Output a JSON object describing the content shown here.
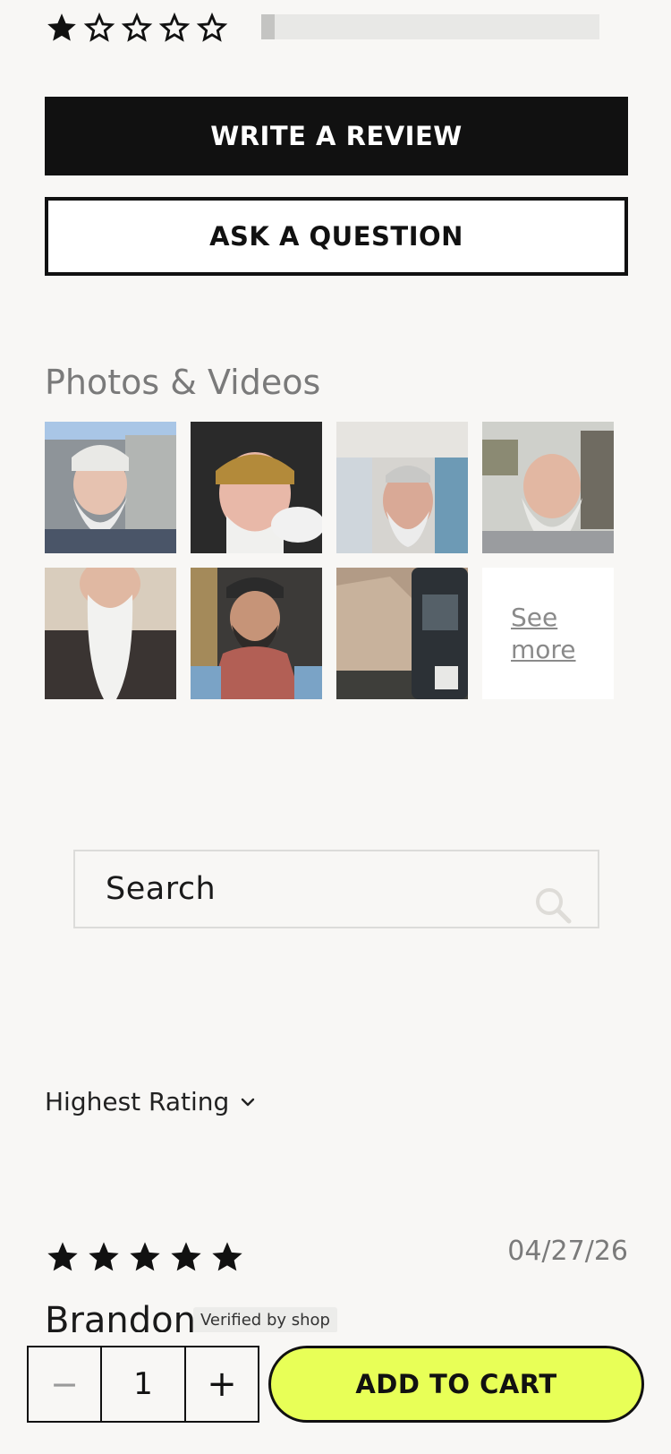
{
  "ratings_summary": {
    "stars_filled": 1,
    "stars_total": 5,
    "bar_fill_fraction": 0.04
  },
  "actions": {
    "write_review_label": "WRITE A REVIEW",
    "ask_question_label": "ASK A QUESTION"
  },
  "media": {
    "title": "Photos & Videos",
    "see_more_line1": "See",
    "see_more_line2": "more"
  },
  "search": {
    "placeholder": "Search"
  },
  "sort": {
    "selected": "Highest Rating"
  },
  "review": {
    "stars": 5,
    "date": "04/27/26",
    "author": "Brandon",
    "badge": "Verified by shop"
  },
  "cart": {
    "quantity": "1",
    "minus_symbol": "−",
    "plus_symbol": "+",
    "add_label": "ADD TO CART"
  },
  "colors": {
    "accent_yellow": "#e8ff57",
    "primary_black": "#111111",
    "background": "#f8f7f5"
  }
}
